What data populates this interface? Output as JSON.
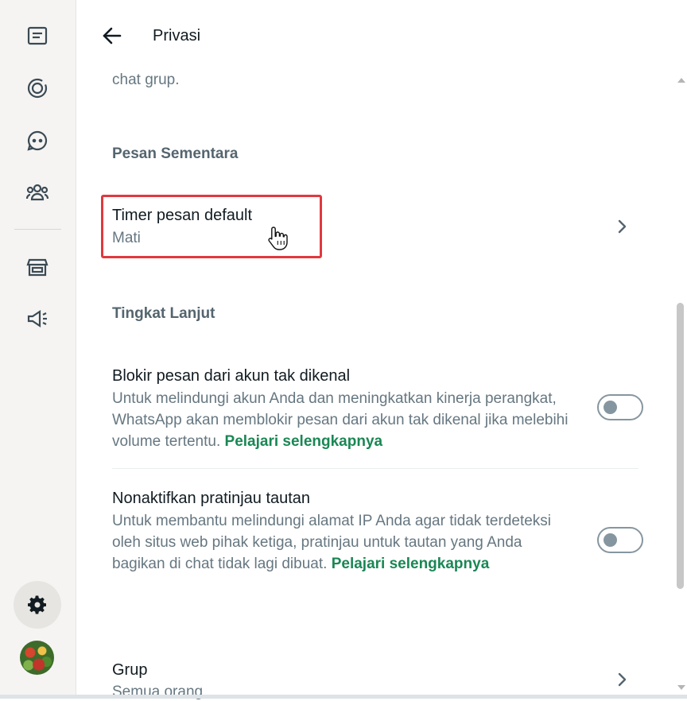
{
  "header": {
    "title": "Privasi"
  },
  "content": {
    "faded_text": "chat grup.",
    "section_disappearing": "Pesan Sementara",
    "timer": {
      "title": "Timer pesan default",
      "value": "Mati"
    },
    "section_advanced": "Tingkat Lanjut",
    "block_unknown": {
      "title": "Blokir pesan dari akun tak dikenal",
      "description": "Untuk melindungi akun Anda dan meningkatkan kinerja perangkat, WhatsApp akan memblokir pesan dari akun tak dikenal jika melebihi volume tertentu.",
      "link": "Pelajari selengkapnya",
      "enabled": false
    },
    "link_preview": {
      "title": "Nonaktifkan pratinjau tautan",
      "description": "Untuk membantu melindungi alamat IP Anda agar tidak terdeteksi oleh situs web pihak ketiga, pratinjau untuk tautan yang Anda bagikan di chat tidak lagi dibuat.",
      "link": "Pelajari selengkapnya",
      "enabled": false
    },
    "groups": {
      "title": "Grup",
      "value": "Semua orang"
    }
  },
  "rail": {
    "icons": [
      "chats-icon",
      "status-icon",
      "channels-icon",
      "communities-icon",
      "store-icon",
      "megaphone-icon",
      "settings-icon",
      "profile-avatar"
    ]
  },
  "colors": {
    "accent_link": "#1a8754",
    "highlight_border": "#e0393e",
    "rail_bg": "#f5f4f2"
  }
}
